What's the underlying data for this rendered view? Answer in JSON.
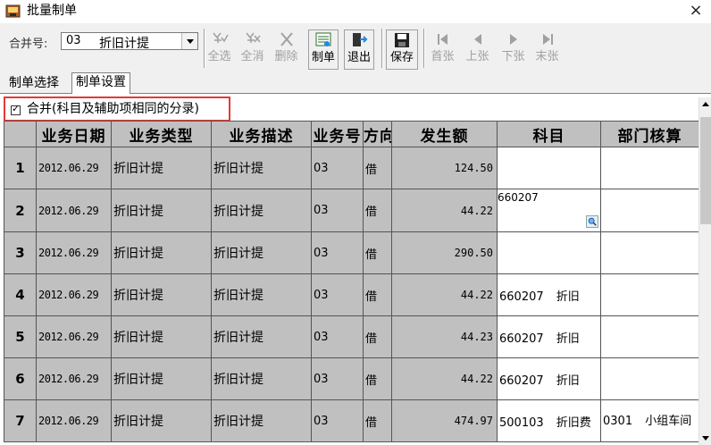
{
  "window": {
    "title": "批量制单",
    "close_glyph": "×",
    "app_icon": "app-icon"
  },
  "toolbar": {
    "merge_label": "合并号:",
    "merge_code": "03",
    "merge_value": "折旧计提",
    "buttons": [
      {
        "label": "全选",
        "icon": "select-all-icon",
        "enabled": false
      },
      {
        "label": "全消",
        "icon": "deselect-all-icon",
        "enabled": false
      },
      {
        "label": "删除",
        "icon": "delete-icon",
        "enabled": false
      },
      {
        "label": "制单",
        "icon": "make-voucher-icon",
        "enabled": true
      },
      {
        "label": "退出",
        "icon": "exit-icon",
        "enabled": true
      },
      {
        "label": "保存",
        "icon": "save-icon",
        "enabled": true
      },
      {
        "label": "首张",
        "icon": "first-icon",
        "enabled": false
      },
      {
        "label": "上张",
        "icon": "prev-icon",
        "enabled": false
      },
      {
        "label": "下张",
        "icon": "next-icon",
        "enabled": false
      },
      {
        "label": "末张",
        "icon": "last-icon",
        "enabled": false
      }
    ]
  },
  "tabs": [
    {
      "label": "制单选择",
      "active": false
    },
    {
      "label": "制单设置",
      "active": true
    }
  ],
  "merge_checkbox": {
    "label": "合并(科目及辅助项相同的分录)",
    "checked": true
  },
  "grid": {
    "columns": [
      "业务日期",
      "业务类型",
      "业务描述",
      "业务号",
      "方向",
      "发生额",
      "科目",
      "部门核算"
    ],
    "rows": [
      {
        "n": "1",
        "date": "2012.06.29",
        "type": "折旧计提",
        "desc": "折旧计提",
        "no": "03",
        "dir": "借",
        "amount": "124.50",
        "subject_code": "",
        "subject_name": "",
        "dept_code": "",
        "dept_name": ""
      },
      {
        "n": "2",
        "date": "2012.06.29",
        "type": "折旧计提",
        "desc": "折旧计提",
        "no": "03",
        "dir": "借",
        "amount": "44.22",
        "subject_code": "660207",
        "subject_name": "",
        "dept_code": "",
        "dept_name": ""
      },
      {
        "n": "3",
        "date": "2012.06.29",
        "type": "折旧计提",
        "desc": "折旧计提",
        "no": "03",
        "dir": "借",
        "amount": "290.50",
        "subject_code": "",
        "subject_name": "",
        "dept_code": "",
        "dept_name": ""
      },
      {
        "n": "4",
        "date": "2012.06.29",
        "type": "折旧计提",
        "desc": "折旧计提",
        "no": "03",
        "dir": "借",
        "amount": "44.22",
        "subject_code": "660207",
        "subject_name": "折旧",
        "dept_code": "",
        "dept_name": ""
      },
      {
        "n": "5",
        "date": "2012.06.29",
        "type": "折旧计提",
        "desc": "折旧计提",
        "no": "03",
        "dir": "借",
        "amount": "44.23",
        "subject_code": "660207",
        "subject_name": "折旧",
        "dept_code": "",
        "dept_name": ""
      },
      {
        "n": "6",
        "date": "2012.06.29",
        "type": "折旧计提",
        "desc": "折旧计提",
        "no": "03",
        "dir": "借",
        "amount": "44.22",
        "subject_code": "660207",
        "subject_name": "折旧",
        "dept_code": "",
        "dept_name": ""
      },
      {
        "n": "7",
        "date": "2012.06.29",
        "type": "折旧计提",
        "desc": "折旧计提",
        "no": "03",
        "dir": "借",
        "amount": "474.97",
        "subject_code": "500103",
        "subject_name": "折旧费",
        "dept_code": "0301",
        "dept_name": "小组车间"
      }
    ]
  }
}
